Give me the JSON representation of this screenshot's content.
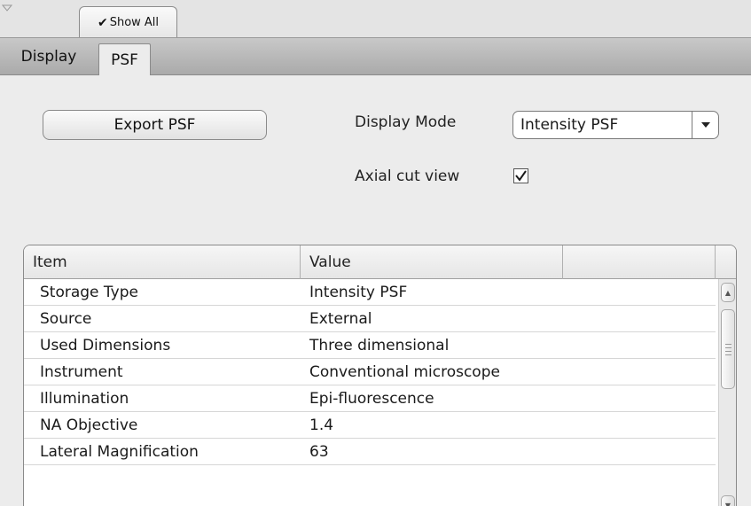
{
  "top": {
    "show_all_check": "✔",
    "show_all_label": "Show All"
  },
  "tabs": [
    {
      "label": "Display",
      "active": false
    },
    {
      "label": "PSF",
      "active": true
    }
  ],
  "controls": {
    "export_label": "Export PSF",
    "display_mode_label": "Display Mode",
    "display_mode_value": "Intensity PSF",
    "axial_cut_label": "Axial cut view",
    "axial_cut_checked": true
  },
  "table": {
    "columns": [
      "Item",
      "Value",
      ""
    ],
    "rows": [
      {
        "item": "Storage Type",
        "value": "Intensity PSF"
      },
      {
        "item": "Source",
        "value": "External"
      },
      {
        "item": "Used Dimensions",
        "value": "Three dimensional"
      },
      {
        "item": "Instrument",
        "value": "Conventional microscope"
      },
      {
        "item": "Illumination",
        "value": "Epi-fluorescence"
      },
      {
        "item": "NA Objective",
        "value": "1.4"
      },
      {
        "item": "Lateral Magnification",
        "value": "63"
      }
    ]
  },
  "colors": {
    "panel_bg": "#ececec",
    "tab_bar": "#b8b8b8",
    "table_bg": "#ffffff"
  }
}
